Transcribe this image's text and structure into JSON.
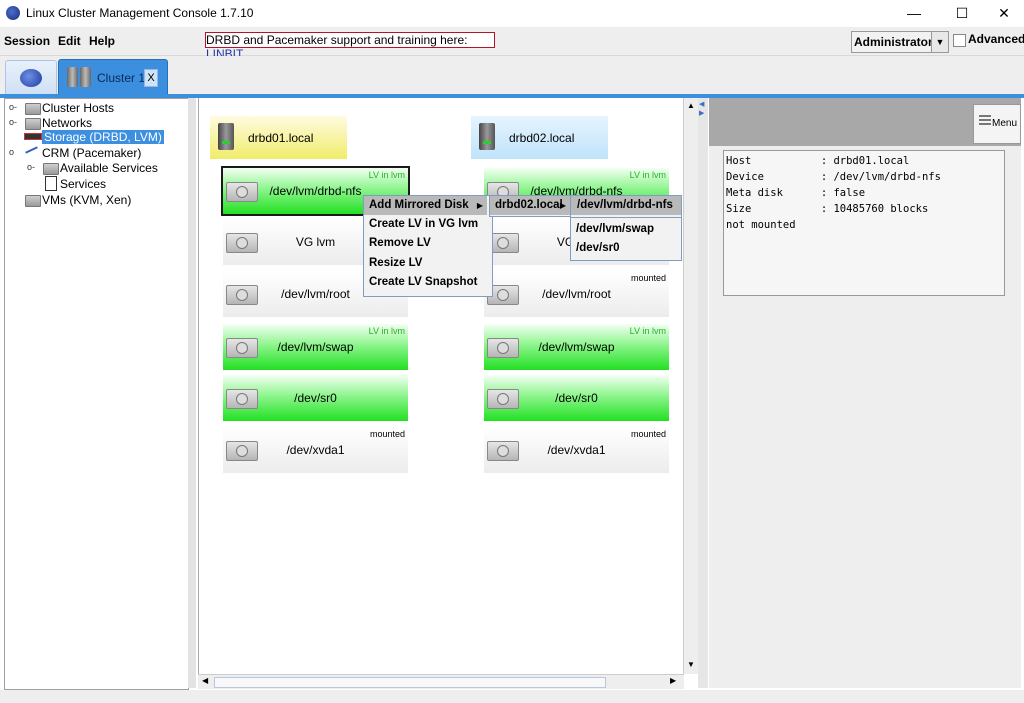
{
  "window": {
    "title": "Linux Cluster Management Console 1.7.10",
    "minimize": "—",
    "maximize": "☐",
    "close": "✕"
  },
  "menubar": {
    "items": [
      "Session",
      "Edit",
      "Help"
    ],
    "banner_text": "DRBD and Pacemaker support and training here: ",
    "banner_link": "LINBIT",
    "user": "Administrator",
    "advanced_label": "Advanced"
  },
  "tabs": {
    "cluster_label": "Cluster 1",
    "close": "X"
  },
  "tree": {
    "items": [
      "Cluster Hosts",
      "Networks",
      "Storage (DRBD, LVM)",
      "CRM (Pacemaker)",
      "Available Services",
      "Services",
      "VMs (KVM, Xen)"
    ]
  },
  "graph": {
    "hosts": [
      "drbd01.local",
      "drbd02.local"
    ],
    "left_blocks": [
      {
        "label": "/dev/lvm/drbd-nfs",
        "tag": "LV in lvm"
      },
      {
        "label": "VG lvm",
        "tag": ""
      },
      {
        "label": "/dev/lvm/root",
        "tag": ""
      },
      {
        "label": "/dev/lvm/swap",
        "tag": "LV in lvm"
      },
      {
        "label": "/dev/sr0",
        "tag": ""
      },
      {
        "label": "/dev/xvda1",
        "tag": "mounted"
      }
    ],
    "right_blocks": [
      {
        "label": "/dev/lvm/drbd-nfs",
        "tag": "LV in lvm"
      },
      {
        "label": "VG lvm",
        "tag": ""
      },
      {
        "label": "/dev/lvm/root",
        "tag": "mounted"
      },
      {
        "label": "/dev/lvm/swap",
        "tag": "LV in lvm"
      },
      {
        "label": "/dev/sr0",
        "tag": ""
      },
      {
        "label": "/dev/xvda1",
        "tag": "mounted"
      }
    ]
  },
  "context_menu": {
    "items": [
      "Add Mirrored Disk",
      "Create LV in VG lvm",
      "Remove LV",
      "Resize LV",
      "Create LV Snapshot"
    ],
    "submenu_host": "drbd02.local",
    "submenu_disks": [
      "/dev/lvm/drbd-nfs",
      "/dev/lvm/swap",
      "/dev/sr0"
    ]
  },
  "right_panel": {
    "menu_label": "Menu",
    "info": [
      "Host           : drbd01.local",
      "Device         : /dev/lvm/drbd-nfs",
      "Meta disk      : false",
      "Size           : 10485760 blocks",
      "not mounted"
    ]
  },
  "colors": {
    "accent": "#3b8fde",
    "lv_green": "#22e022",
    "host_left": "#f0ec6a",
    "host_right": "#bfe3fb"
  }
}
